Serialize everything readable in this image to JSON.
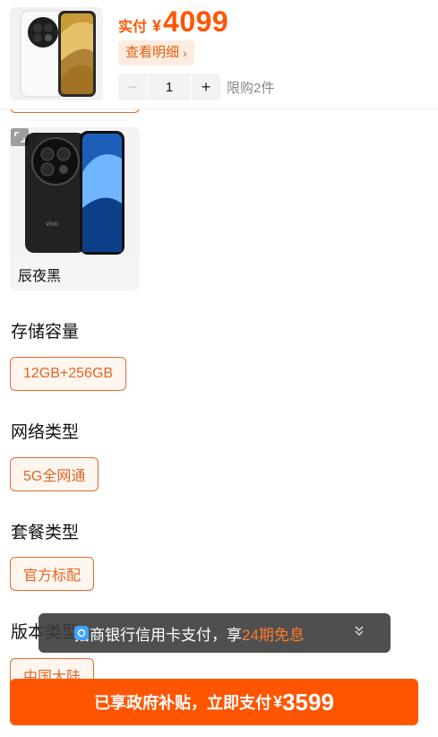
{
  "header": {
    "price_label": "实付",
    "currency": "¥",
    "price": "4099",
    "detail_label": "查看明细",
    "quantity": "1",
    "minus": "−",
    "plus": "+",
    "limit_text": "限购2件"
  },
  "color_option": {
    "name": "辰夜黑"
  },
  "sections": {
    "storage": {
      "title": "存储容量",
      "option": "12GB+256GB"
    },
    "network": {
      "title": "网络类型",
      "option": "5G全网通"
    },
    "package": {
      "title": "套餐类型",
      "option": "官方标配"
    },
    "version": {
      "title": "版本类型",
      "option": "中国大陆"
    }
  },
  "toast": {
    "text_main": "招商银行信用卡支付，享",
    "text_highlight": "24期免息"
  },
  "cta": {
    "label": "已享政府补贴，立即支付",
    "currency": "¥",
    "amount": "3599"
  },
  "colors": {
    "accent": "#ff5500",
    "option_border": "#e36a2b"
  }
}
